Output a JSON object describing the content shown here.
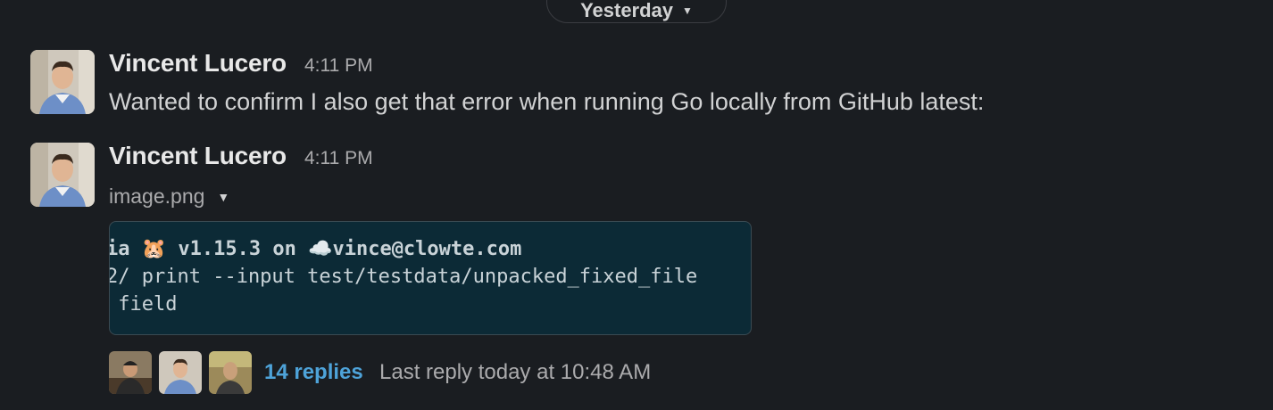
{
  "divider": {
    "label": "Yesterday",
    "chevron_icon": "chevron-down-icon"
  },
  "messages": [
    {
      "author": "Vincent Lucero",
      "time": "4:11 PM",
      "text": "Wanted to confirm I also get that error when running Go locally from GitHub latest:"
    },
    {
      "author": "Vincent Lucero",
      "time": "4:11 PM",
      "file_name": "image.png",
      "image_lines": [
        "ia 🐹 v1.15.3 on ☁️vince@clowte.com",
        "2/ print --input test/testdata/unpacked_fixed_file",
        " field"
      ]
    }
  ],
  "thread": {
    "replies": "14 replies",
    "last_reply": "Last reply today at 10:48 AM"
  },
  "colors": {
    "background": "#1a1d21",
    "link": "#4ea3d9",
    "image_bg": "#0c2a36"
  }
}
